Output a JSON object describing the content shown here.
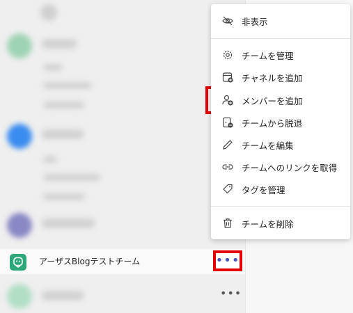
{
  "colors": {
    "highlight_border": "#e40000",
    "accent": "#4b53bc",
    "team_avatar": "#2ea87a"
  },
  "team": {
    "name": "アーザスBlogテストチーム",
    "more_label": "•••"
  },
  "next_team": {
    "more_label": "•••"
  },
  "menu": {
    "items": [
      {
        "label": "非表示",
        "icon": "eye-off-icon"
      },
      {
        "label": "チームを管理",
        "icon": "gear-icon"
      },
      {
        "label": "チャネルを追加",
        "icon": "add-channel-icon"
      },
      {
        "label": "メンバーを追加",
        "icon": "add-person-icon"
      },
      {
        "label": "チームから脱退",
        "icon": "leave-icon"
      },
      {
        "label": "チームを編集",
        "icon": "pencil-icon"
      },
      {
        "label": "チームへのリンクを取得",
        "icon": "link-icon"
      },
      {
        "label": "タグを管理",
        "icon": "tag-icon"
      },
      {
        "label": "チームを削除",
        "icon": "trash-icon"
      }
    ]
  }
}
